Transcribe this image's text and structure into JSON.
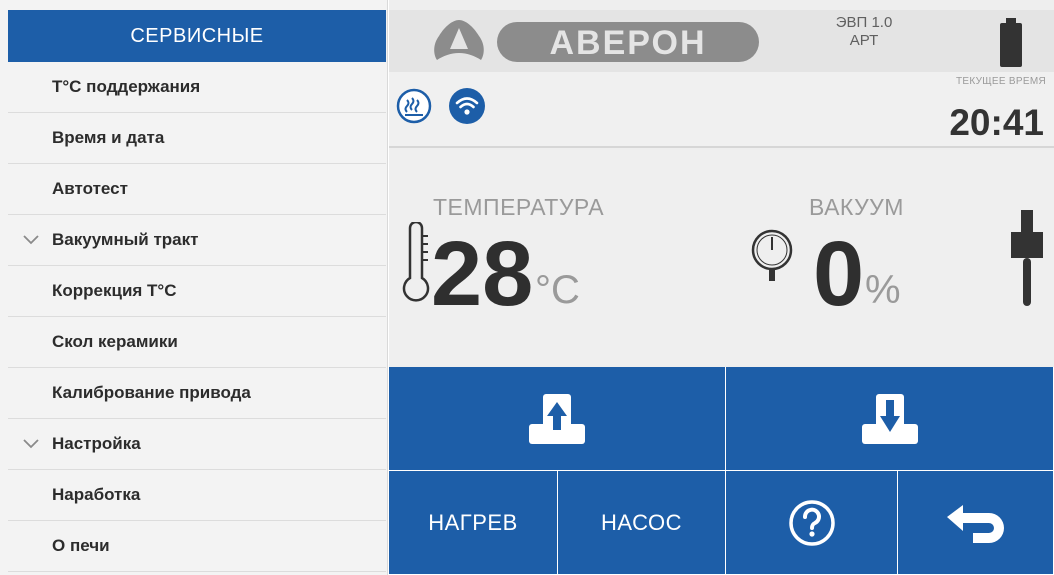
{
  "sidebar": {
    "header": "СЕРВИСНЫЕ",
    "items": [
      {
        "label": "T°C поддержания",
        "chevron": false
      },
      {
        "label": "Время и дата",
        "chevron": false
      },
      {
        "label": "Автотест",
        "chevron": false
      },
      {
        "label": "Вакуумный тракт",
        "chevron": true
      },
      {
        "label": "Коррекция T°C",
        "chevron": false
      },
      {
        "label": "Скол керамики",
        "chevron": false
      },
      {
        "label": "Калибрование привода",
        "chevron": false
      },
      {
        "label": "Настройка",
        "chevron": true
      },
      {
        "label": "Наработка",
        "chevron": false
      },
      {
        "label": "О печи",
        "chevron": false
      }
    ]
  },
  "header": {
    "brand": "АВЕРОН",
    "version_line1": "ЭВП 1.0",
    "version_line2": "АРТ",
    "icons": [
      "averon-logo-icon",
      "battery-icon"
    ]
  },
  "status": {
    "time_caption": "ТЕКУЩЕЕ ВРЕМЯ",
    "time": "20:41",
    "icons": [
      "heating-icon",
      "wifi-icon"
    ]
  },
  "readings": {
    "temperature_label": "ТЕМПЕРАТУРА",
    "temperature_value": "28",
    "temperature_unit": "°C",
    "vacuum_label": "ВАКУУМ",
    "vacuum_value": "0",
    "vacuum_unit": "%",
    "icons": [
      "thermometer-icon",
      "pressure-gauge-icon",
      "lift-plunger-icon"
    ]
  },
  "controls": {
    "lift_up_icon": "lift-up-icon",
    "lift_down_icon": "lift-down-icon",
    "heat_label": "НАГРЕВ",
    "pump_label": "НАСОС",
    "help_icon": "help-icon",
    "back_icon": "back-arrow-icon"
  },
  "colors": {
    "accent": "#1d5ea8",
    "text_dark": "#2f2f2f",
    "text_muted": "#9a9a9a",
    "background": "#eeeeee"
  }
}
